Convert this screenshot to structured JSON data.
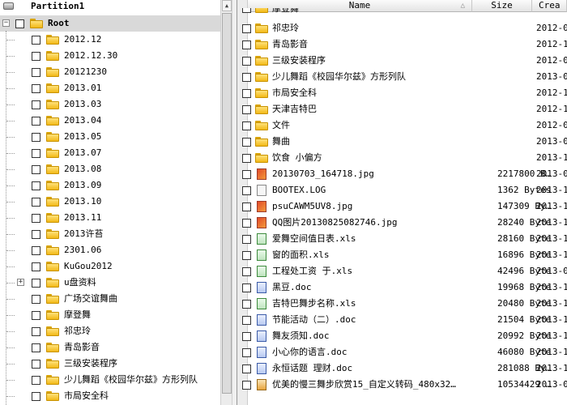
{
  "tree": {
    "partition": "Partition1",
    "root": "Root",
    "items": [
      "2012.12",
      "2012.12.30",
      "20121230",
      "2013.01",
      "2013.03",
      "2013.04",
      "2013.05",
      "2013.07",
      "2013.08",
      "2013.09",
      "2013.10",
      "2013.11",
      "2013许苔",
      "2301.06",
      "KuGou2012",
      "u盘资料",
      "广场交谊舞曲",
      "摩登舞",
      "祁忠玲",
      "青岛影音",
      "三级安装程序",
      "少儿舞蹈《校园华尔兹》方形列队",
      "市局安全科"
    ]
  },
  "list": {
    "columns": {
      "name": "Name",
      "size": "Size",
      "created": "Crea"
    },
    "partial_top": "摩登舞",
    "rows": [
      {
        "name": "祁忠玲",
        "size": "",
        "created": "2012-0",
        "type": "folder"
      },
      {
        "name": "青岛影音",
        "size": "",
        "created": "2012-1",
        "type": "folder"
      },
      {
        "name": "三级安装程序",
        "size": "",
        "created": "2012-0",
        "type": "folder"
      },
      {
        "name": "少儿舞蹈《校园华尔兹》方形列队",
        "size": "",
        "created": "2013-0",
        "type": "folder"
      },
      {
        "name": "市局安全科",
        "size": "",
        "created": "2012-1",
        "type": "folder"
      },
      {
        "name": "天津吉特巴",
        "size": "",
        "created": "2012-1",
        "type": "folder"
      },
      {
        "name": "文件",
        "size": "",
        "created": "2012-0",
        "type": "folder"
      },
      {
        "name": "舞曲",
        "size": "",
        "created": "2013-0",
        "type": "folder"
      },
      {
        "name": "饮食 小偏方",
        "size": "",
        "created": "2013-1",
        "type": "folder"
      },
      {
        "name": "20130703_164718.jpg",
        "size": "2217800 B…",
        "created": "2013-0",
        "type": "jpg"
      },
      {
        "name": "BOOTEX.LOG",
        "size": "1362 Bytes",
        "created": "2013-1",
        "type": "log"
      },
      {
        "name": "psuCAWM5UV8.jpg",
        "size": "147309 By…",
        "created": "2013-1",
        "type": "jpg"
      },
      {
        "name": "QQ图片20130825082746.jpg",
        "size": "28240 Bytes",
        "created": "2013-1",
        "type": "jpg"
      },
      {
        "name": "爱舞空间值日表.xls",
        "size": "28160 Bytes",
        "created": "2013-1",
        "type": "xls"
      },
      {
        "name": "窗的面积.xls",
        "size": "16896 Bytes",
        "created": "2013-1",
        "type": "xls"
      },
      {
        "name": "工程处工资 于.xls",
        "size": "42496 Bytes",
        "created": "2013-0",
        "type": "xls"
      },
      {
        "name": "黑豆.doc",
        "size": "19968 Bytes",
        "created": "2013-1",
        "type": "doc"
      },
      {
        "name": "吉特巴舞步名称.xls",
        "size": "20480 Bytes",
        "created": "2013-1",
        "type": "xls"
      },
      {
        "name": "节能活动（二）.doc",
        "size": "21504 Bytes",
        "created": "2013-1",
        "type": "doc"
      },
      {
        "name": "舞友须知.doc",
        "size": "20992 Bytes",
        "created": "2013-1",
        "type": "doc"
      },
      {
        "name": "小心你的语言.doc",
        "size": "46080 Bytes",
        "created": "2013-1",
        "type": "doc"
      },
      {
        "name": "永恒话题 理财.doc",
        "size": "281088 By…",
        "created": "2013-1",
        "type": "doc"
      },
      {
        "name": "优美的慢三舞步欣赏15_自定义转码_480x32…",
        "size": "10534429 …",
        "created": "2013-0",
        "type": "vid"
      }
    ]
  }
}
